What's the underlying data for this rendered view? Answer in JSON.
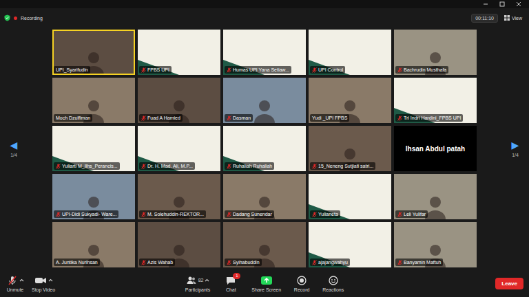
{
  "header": {
    "recording": "Recording",
    "timer": "00:11:10",
    "view": "View"
  },
  "pager": {
    "prev": "◀",
    "next": "▶",
    "left_page": "1/4",
    "right_page": "1/4"
  },
  "tiles": [
    {
      "name": "UPI_Syarifudin",
      "kind": "camera",
      "muted": false,
      "speaking": true
    },
    {
      "name": "FPBS UPI",
      "kind": "graphic",
      "muted": true,
      "speaking": false
    },
    {
      "name": "Humas UPI Yana Setiaw...",
      "kind": "graphic",
      "muted": true,
      "speaking": false
    },
    {
      "name": "UPI Control",
      "kind": "graphic",
      "muted": true,
      "speaking": false
    },
    {
      "name": "Bachrudin Musthafa",
      "kind": "camera",
      "muted": true,
      "speaking": false
    },
    {
      "name": "Moch Dzulfiman",
      "kind": "camera",
      "muted": false,
      "speaking": false
    },
    {
      "name": "Fuad A Hamied",
      "kind": "camera",
      "muted": true,
      "speaking": false
    },
    {
      "name": "Dasman",
      "kind": "camera",
      "muted": true,
      "speaking": false
    },
    {
      "name": "Yudi _UPI FPBS",
      "kind": "camera",
      "muted": false,
      "speaking": false
    },
    {
      "name": "Tri Indri Hardini_FPBS UPI",
      "kind": "graphic",
      "muted": true,
      "speaking": false
    },
    {
      "name": "Yuliarti M_Ilhs_Perancis...",
      "kind": "graphic",
      "muted": true,
      "speaking": false
    },
    {
      "name": "Dr. H. Mad. Ali, M.P...",
      "kind": "graphic",
      "muted": true,
      "speaking": false
    },
    {
      "name": "Ruhaliah Ruhaliah",
      "kind": "graphic",
      "muted": true,
      "speaking": false
    },
    {
      "name": "15_Neneng Sutjiati satri...",
      "kind": "camera",
      "muted": true,
      "speaking": false
    },
    {
      "name": "Ihsan Abdul patah",
      "kind": "name",
      "muted": false,
      "speaking": false
    },
    {
      "name": "UPI-Didi Sukyadi- Ware...",
      "kind": "camera",
      "muted": true,
      "speaking": false
    },
    {
      "name": "M. Solehuddin-REKTOR...",
      "kind": "camera",
      "muted": true,
      "speaking": false
    },
    {
      "name": "Dadang Sunendar",
      "kind": "camera",
      "muted": true,
      "speaking": false
    },
    {
      "name": "Yulianeta",
      "kind": "graphic",
      "muted": true,
      "speaking": false
    },
    {
      "name": "Leli Yulifar",
      "kind": "camera",
      "muted": true,
      "speaking": false
    },
    {
      "name": "A. Juntika Nurihsan",
      "kind": "camera",
      "muted": false,
      "speaking": false
    },
    {
      "name": "Azis Wahab",
      "kind": "camera",
      "muted": true,
      "speaking": false
    },
    {
      "name": "Syihabuddin",
      "kind": "camera",
      "muted": true,
      "speaking": false
    },
    {
      "name": "ajajangwahyu",
      "kind": "graphic",
      "muted": true,
      "speaking": false
    },
    {
      "name": "Banyamin Maftuh",
      "kind": "camera",
      "muted": true,
      "speaking": false
    }
  ],
  "toolbar": {
    "left": [
      {
        "label": "Unmute",
        "kind": "mic",
        "has_menu": true,
        "count": "",
        "badge": ""
      },
      {
        "label": "Stop Video",
        "kind": "video",
        "has_menu": true,
        "count": "",
        "badge": ""
      }
    ],
    "center": [
      {
        "label": "Participants",
        "kind": "participants",
        "has_menu": true,
        "count": "82",
        "badge": ""
      },
      {
        "label": "Chat",
        "kind": "chat",
        "has_menu": false,
        "count": "",
        "badge": "1"
      },
      {
        "label": "Share Screen",
        "kind": "share",
        "has_menu": false,
        "count": "",
        "badge": ""
      },
      {
        "label": "Record",
        "kind": "record",
        "has_menu": false,
        "count": "",
        "badge": ""
      },
      {
        "label": "Reactions",
        "kind": "reactions",
        "has_menu": false,
        "count": "",
        "badge": ""
      }
    ],
    "leave": "Leave"
  }
}
